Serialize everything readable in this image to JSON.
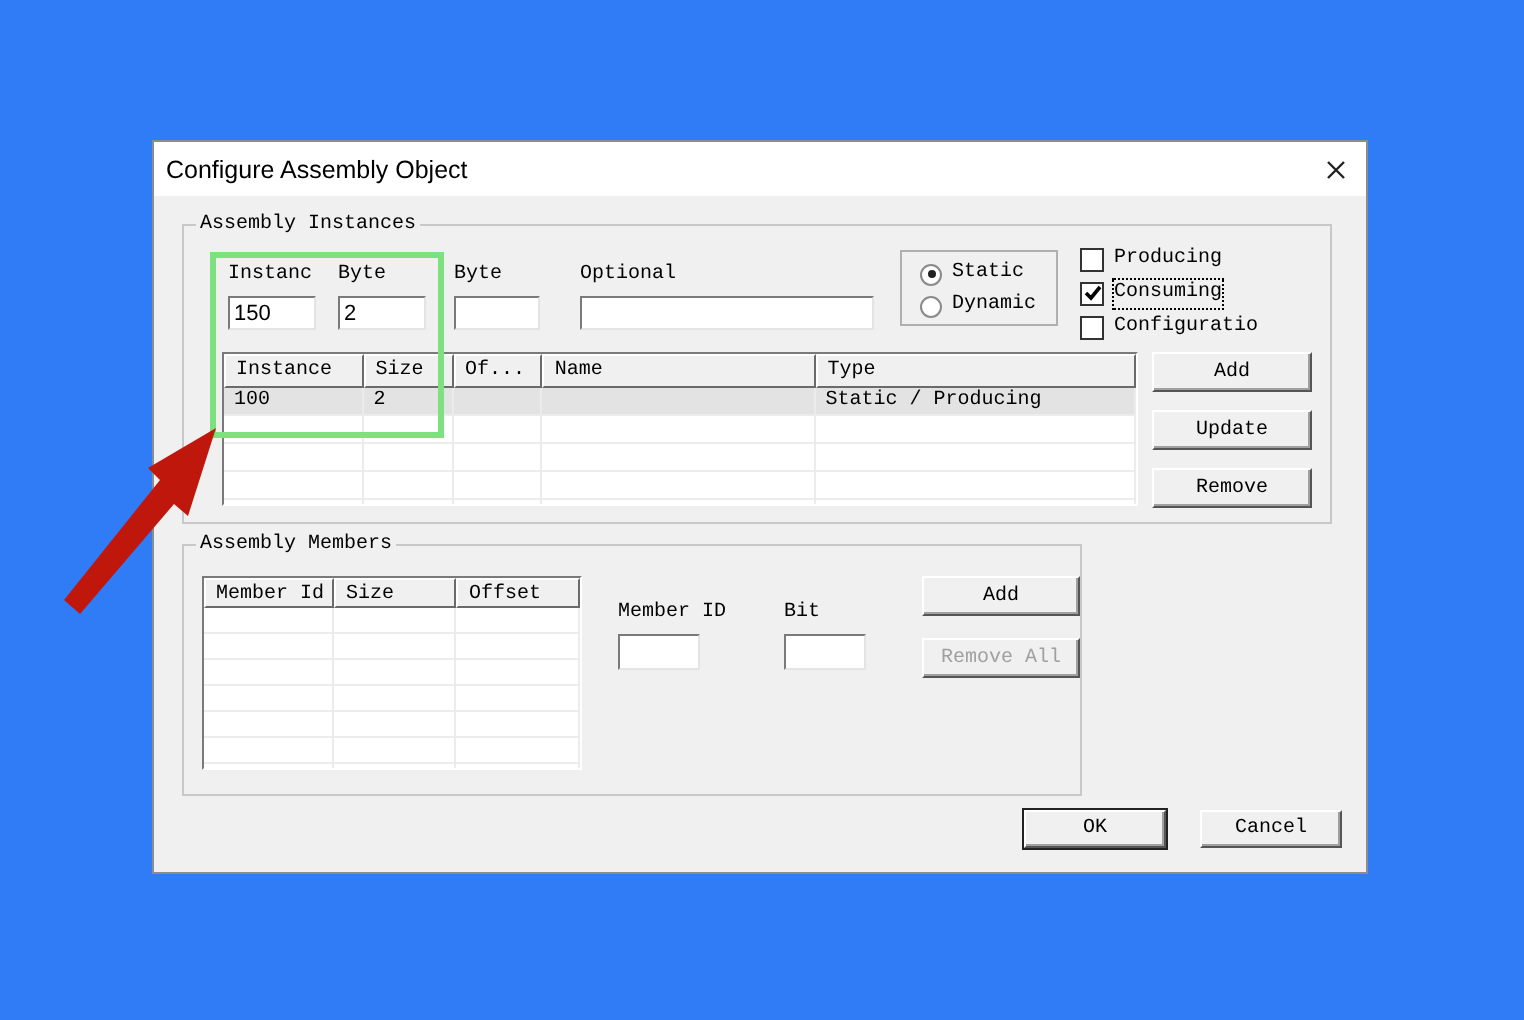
{
  "window": {
    "title": "Configure Assembly Object"
  },
  "instances": {
    "label": "Assembly Instances",
    "fields": [
      {
        "label": "Instanc",
        "value": "150"
      },
      {
        "label": "Byte",
        "value": "2"
      },
      {
        "label": "Byte"
      },
      {
        "label": "Optional"
      }
    ],
    "type_options": [
      {
        "label": "Static",
        "selected": true
      },
      {
        "label": "Dynamic",
        "selected": false
      }
    ],
    "roles": [
      {
        "label": "Producing",
        "checked": false,
        "focused": false
      },
      {
        "label": "Consuming",
        "checked": true,
        "focused": true
      },
      {
        "label": "Configuratio",
        "checked": false,
        "focused": false
      }
    ],
    "table": {
      "columns": [
        "Instance",
        "Size",
        "Of...",
        "Name",
        "Type"
      ],
      "rows": [
        {
          "cells": [
            "100",
            "2",
            null,
            null,
            "Static / Producing"
          ],
          "selected": true
        }
      ]
    },
    "buttons": [
      {
        "label": "Add",
        "disabled": false
      },
      {
        "label": "Update",
        "disabled": false
      },
      {
        "label": "Remove",
        "disabled": false
      }
    ]
  },
  "members": {
    "label": "Assembly Members",
    "table": {
      "columns": [
        "Member Id",
        "Size",
        "Offset"
      ]
    },
    "fields": [
      {
        "label": "Member ID"
      },
      {
        "label": "Bit"
      }
    ],
    "buttons": [
      {
        "label": "Add",
        "disabled": false
      },
      {
        "label": "Remove All",
        "disabled": true
      }
    ]
  },
  "footer_buttons": [
    {
      "label": "OK",
      "default": true
    },
    {
      "label": "Cancel",
      "default": false
    }
  ],
  "annotations": [
    {
      "kind": "highlight-box",
      "color": "#7fe07f"
    },
    {
      "kind": "arrow",
      "color": "#c0170d"
    }
  ]
}
